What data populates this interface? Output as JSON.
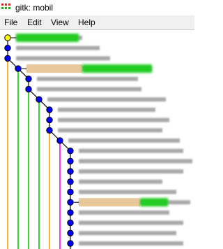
{
  "window": {
    "title": "gitk: mobil"
  },
  "menu": {
    "items": [
      "File",
      "Edit",
      "View",
      "Help"
    ]
  },
  "icons": {
    "app": "gitk-app-icon"
  },
  "commit_list": {
    "commit_count": 22,
    "head_commit_index": 0,
    "head_color": "#ffff00",
    "commit_color": "#0000ff",
    "branch_colors": [
      "#ff9900",
      "#00cc00",
      "#00cc00",
      "#00cc00",
      "#ff9900",
      "#ff00ff"
    ],
    "tag_highlight_color": "#e8c79a",
    "branch_highlight_color": "#22cc22",
    "summaries_blurred": true
  }
}
